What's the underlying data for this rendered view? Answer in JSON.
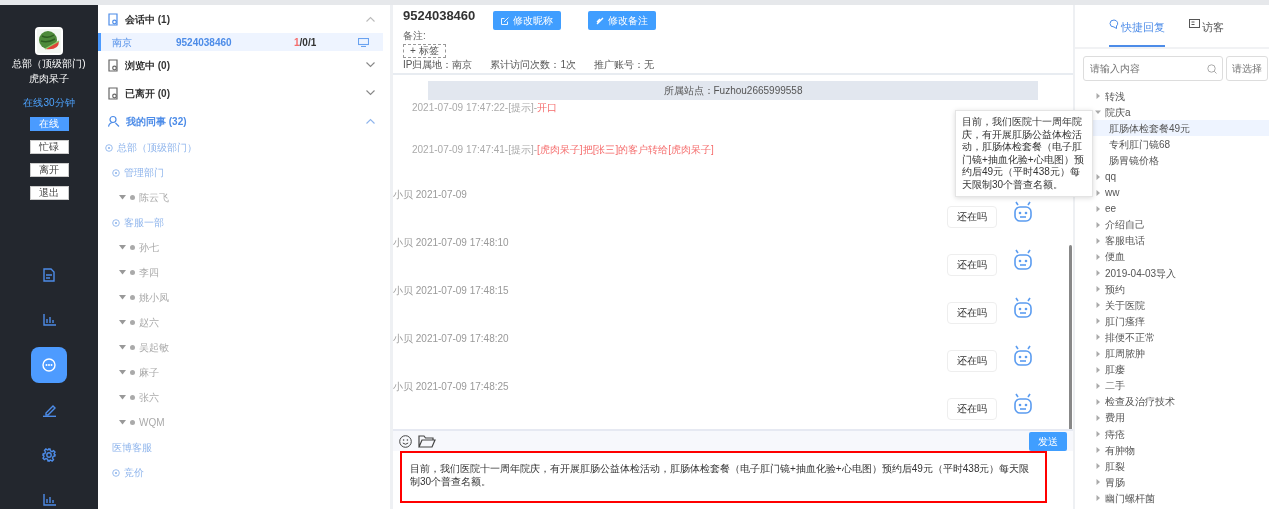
{
  "sidebar": {
    "department": "总部（顶级部门)",
    "user": "虎肉呆子",
    "online_time": "在线30分钟",
    "status_buttons": [
      {
        "label": "在线",
        "selected": true
      },
      {
        "label": "忙碌",
        "selected": false
      },
      {
        "label": "离开",
        "selected": false
      },
      {
        "label": "退出",
        "selected": false
      }
    ],
    "nav": [
      {
        "kind": "document",
        "selected": false
      },
      {
        "kind": "chart",
        "selected": false
      },
      {
        "kind": "chat",
        "selected": true
      },
      {
        "kind": "pen",
        "selected": false
      },
      {
        "kind": "gear",
        "selected": false
      },
      {
        "kind": "chart",
        "selected": false
      }
    ]
  },
  "sessions": {
    "sections": [
      {
        "kind": "chat",
        "label": "会话中 (1)",
        "expanded": true,
        "rows": [
          {
            "city": "南京",
            "visitor_id": "9524038460",
            "unread": "1",
            "counts": "/0/1",
            "selected": true
          }
        ]
      },
      {
        "kind": "browse",
        "label": "浏览中 (0)",
        "expanded": false
      },
      {
        "kind": "left",
        "label": "已离开 (0)",
        "expanded": false
      },
      {
        "kind": "colleagues",
        "label": "我的同事 (32)",
        "expanded": true,
        "tree": [
          {
            "kind": "dept",
            "label": "总部（顶级部门）",
            "children": [
              {
                "kind": "dept",
                "label": "管理部门",
                "children": [
                  {
                    "kind": "person",
                    "label": "陈云飞"
                  }
                ]
              },
              {
                "kind": "dept",
                "label": "客服一部",
                "children": [
                  {
                    "kind": "person",
                    "label": "孙七"
                  },
                  {
                    "kind": "person",
                    "label": "李四"
                  },
                  {
                    "kind": "person",
                    "label": "姚小凤"
                  },
                  {
                    "kind": "person",
                    "label": "赵六"
                  },
                  {
                    "kind": "person",
                    "label": "吴起敏"
                  },
                  {
                    "kind": "person",
                    "label": "麻子"
                  },
                  {
                    "kind": "person",
                    "label": "张六"
                  },
                  {
                    "kind": "person",
                    "label": "WQM"
                  }
                ]
              },
              {
                "kind": "group",
                "label": "医博客服"
              },
              {
                "kind": "dept",
                "label": "竞价"
              }
            ]
          }
        ]
      }
    ]
  },
  "chat": {
    "title": "9524038460",
    "buttons": [
      {
        "kind": "edit",
        "label": "修改昵称"
      },
      {
        "kind": "tag",
        "label": "修改备注"
      }
    ],
    "note_label": "备注:",
    "tag_button": "+ 标签",
    "info": [
      "IP归属地：南京",
      "累计访问次数：1次",
      "推广账号：无"
    ],
    "site_banner": "所属站点：Fuzhou2665999558",
    "messages": [
      {
        "kind": "system",
        "meta": "2021-07-09 17:47:22-[提示]-",
        "text": "开口"
      },
      {
        "kind": "system",
        "meta": "2021-07-09 17:47:41-[提示]-",
        "text": "[虎肉呆子]把[张三]的客户转给[虎肉呆子]"
      },
      {
        "kind": "agent",
        "meta": "小贝 2021-07-09",
        "text": "还在吗"
      },
      {
        "kind": "agent",
        "meta": "小贝 2021-07-09 17:48:10",
        "text": "还在吗"
      },
      {
        "kind": "agent",
        "meta": "小贝 2021-07-09 17:48:15",
        "text": "还在吗"
      },
      {
        "kind": "agent",
        "meta": "小贝 2021-07-09 17:48:20",
        "text": "还在吗"
      },
      {
        "kind": "agent",
        "meta": "小贝 2021-07-09 17:48:25",
        "text": "还在吗"
      }
    ],
    "input": {
      "value": "目前，我们医院十一周年院庆，有开展肛肠公益体检活动，肛肠体检套餐（电子肛门镜+抽血化验+心电图）预约后49元（平时438元）每天限制30个普查名额。"
    },
    "send_button": "发送"
  },
  "tooltip": "目前，我们医院十一周年院庆，有开展肛肠公益体检活动，肛肠体检套餐（电子肛门镜+抽血化验+心电图）预约后49元（平时438元）每天限制30个普查名额。",
  "quick_reply": {
    "tabs": [
      {
        "label": "快捷回复",
        "selected": true
      },
      {
        "label": "访客",
        "selected": false
      }
    ],
    "search": {
      "placeholder": "请输入内容"
    },
    "select": {
      "placeholder": "请选择"
    },
    "tree": [
      {
        "label": "转浅",
        "expanded": false
      },
      {
        "label": "院庆a",
        "expanded": true,
        "children": [
          {
            "label": "肛肠体检套餐49元",
            "selected": true
          },
          {
            "label": "专利肛门镜68",
            "selected": false
          },
          {
            "label": "肠胃镜价格",
            "selected": false
          }
        ]
      },
      {
        "label": "qq",
        "expanded": false
      },
      {
        "label": "ww",
        "expanded": false
      },
      {
        "label": "ee",
        "expanded": false
      },
      {
        "label": "介绍自己",
        "expanded": false
      },
      {
        "label": "客服电话",
        "expanded": false
      },
      {
        "label": "便血",
        "expanded": false
      },
      {
        "label": "2019-04-03导入",
        "expanded": false
      },
      {
        "label": "预约",
        "expanded": false
      },
      {
        "label": "关于医院",
        "expanded": false
      },
      {
        "label": "肛门瘙痒",
        "expanded": false
      },
      {
        "label": "排便不正常",
        "expanded": false
      },
      {
        "label": "肛周脓肿",
        "expanded": false
      },
      {
        "label": "肛瘘",
        "expanded": false
      },
      {
        "label": "二手",
        "expanded": false
      },
      {
        "label": "检查及治疗技术",
        "expanded": false
      },
      {
        "label": "费用",
        "expanded": false
      },
      {
        "label": "痔疮",
        "expanded": false
      },
      {
        "label": "有肿物",
        "expanded": false
      },
      {
        "label": "肛裂",
        "expanded": false
      },
      {
        "label": "胃肠",
        "expanded": false
      },
      {
        "label": "幽门螺杆菌",
        "expanded": false
      }
    ]
  }
}
